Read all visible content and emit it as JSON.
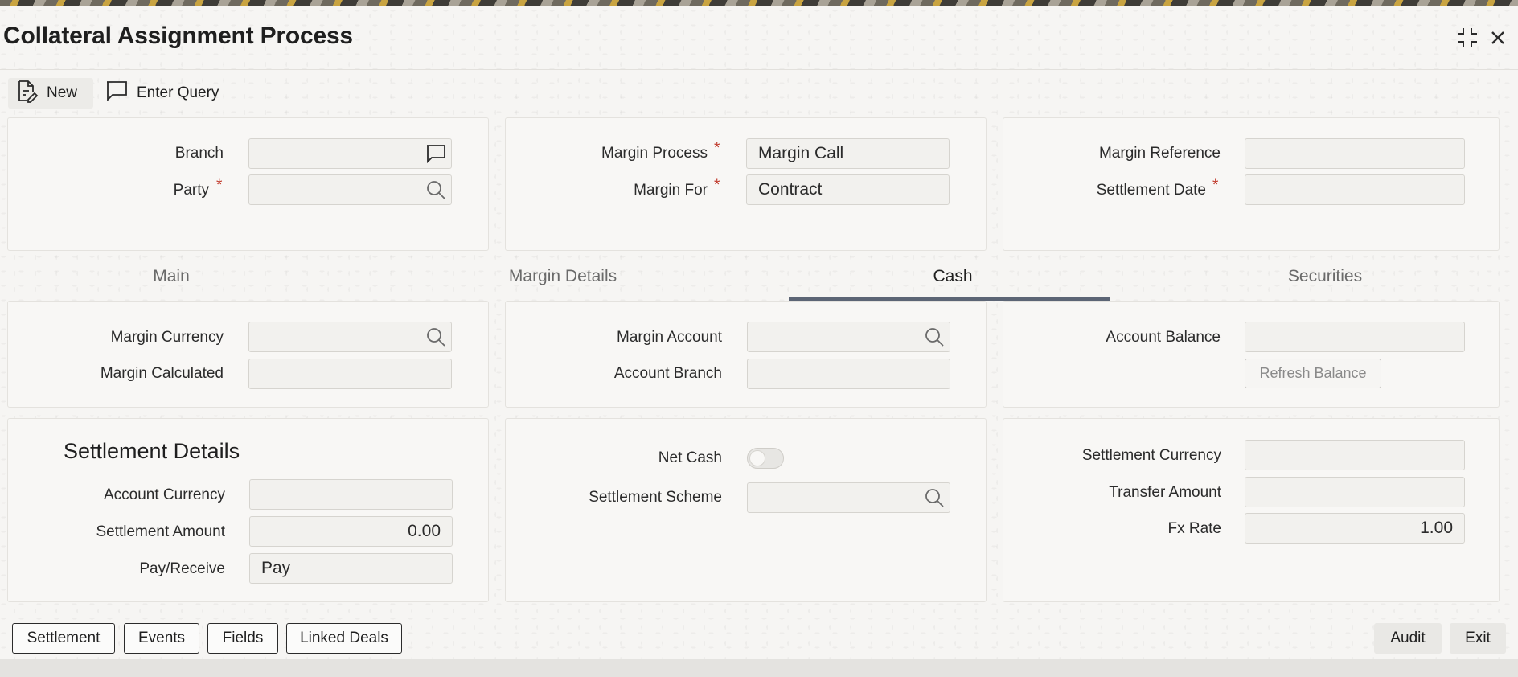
{
  "window": {
    "title": "Collateral Assignment Process",
    "controls": {
      "collapse_icon": "collapse-icon",
      "close_icon": "close-icon"
    }
  },
  "toolbar": {
    "new_label": "New",
    "new_icon": "new-document-icon",
    "query_label": "Enter Query",
    "query_icon": "speech-bubble-icon"
  },
  "header": {
    "branch_label": "Branch",
    "branch_value": "",
    "party_label": "Party",
    "party_value": "",
    "margin_process_label": "Margin Process",
    "margin_process_value": "Margin Call",
    "margin_for_label": "Margin For",
    "margin_for_value": "Contract",
    "margin_reference_label": "Margin Reference",
    "margin_reference_value": "",
    "settlement_date_label": "Settlement Date",
    "settlement_date_value": "",
    "required_mark": "*"
  },
  "tabs": {
    "items": [
      "Main",
      "Margin Details",
      "Cash",
      "Securities"
    ],
    "active": "Cash"
  },
  "cash": {
    "margin_currency_label": "Margin Currency",
    "margin_currency_value": "",
    "margin_calculated_label": "Margin Calculated",
    "margin_calculated_value": "",
    "margin_account_label": "Margin Account",
    "margin_account_value": "",
    "account_branch_label": "Account Branch",
    "account_branch_value": "",
    "account_balance_label": "Account Balance",
    "account_balance_value": "",
    "refresh_balance_label": "Refresh Balance"
  },
  "settlement": {
    "section_title": "Settlement Details",
    "account_currency_label": "Account Currency",
    "account_currency_value": "",
    "settlement_amount_label": "Settlement Amount",
    "settlement_amount_value": "0.00",
    "pay_receive_label": "Pay/Receive",
    "pay_receive_value": "Pay",
    "net_cash_label": "Net Cash",
    "net_cash_on": false,
    "settlement_scheme_label": "Settlement Scheme",
    "settlement_scheme_value": "",
    "settlement_currency_label": "Settlement Currency",
    "settlement_currency_value": "",
    "transfer_amount_label": "Transfer Amount",
    "transfer_amount_value": "",
    "fx_rate_label": "Fx Rate",
    "fx_rate_value": "1.00"
  },
  "footer": {
    "buttons": [
      "Settlement",
      "Events",
      "Fields",
      "Linked Deals"
    ],
    "audit_label": "Audit",
    "exit_label": "Exit"
  },
  "colors": {
    "accent_underline": "#5c6575",
    "required": "#c0392b"
  }
}
